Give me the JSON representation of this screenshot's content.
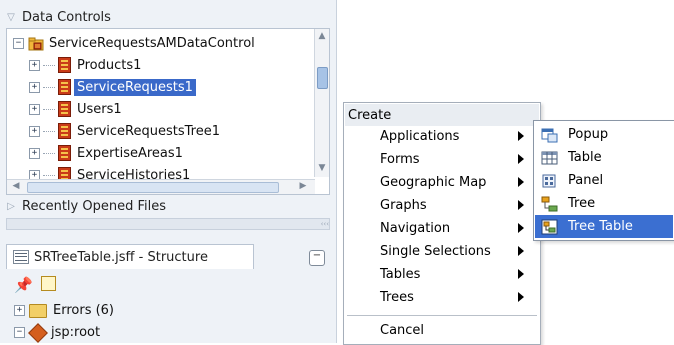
{
  "data_controls": {
    "header": "Data Controls",
    "root": "ServiceRequestsAMDataControl",
    "items": [
      {
        "label": "Products1"
      },
      {
        "label": "ServiceRequests1"
      },
      {
        "label": "Users1"
      },
      {
        "label": "ServiceRequestsTree1"
      },
      {
        "label": "ExpertiseAreas1"
      },
      {
        "label": "ServiceHistories1"
      }
    ],
    "selected_item": "ServiceRequests1"
  },
  "recent_files": {
    "header": "Recently Opened Files"
  },
  "structure": {
    "tab_title": "SRTreeTable.jsff - Structure",
    "nodes": [
      {
        "label": "Errors (6)"
      },
      {
        "label": "jsp:root"
      }
    ]
  },
  "context_menu": {
    "header": "Create",
    "items": [
      {
        "label": "Applications"
      },
      {
        "label": "Forms"
      },
      {
        "label": "Geographic Map"
      },
      {
        "label": "Graphs"
      },
      {
        "label": "Navigation"
      },
      {
        "label": "Single Selections"
      },
      {
        "label": "Tables"
      },
      {
        "label": "Trees"
      }
    ],
    "cancel": "Cancel"
  },
  "submenu": {
    "items": [
      {
        "label": "Popup",
        "icon": "popup-icon"
      },
      {
        "label": "Table",
        "icon": "table-icon"
      },
      {
        "label": "Panel",
        "icon": "panel-icon"
      },
      {
        "label": "Tree",
        "icon": "tree-icon"
      },
      {
        "label": "Tree Table",
        "icon": "tree-table-icon"
      }
    ],
    "highlighted": "Tree Table"
  },
  "colors": {
    "selection": "#3a69c9",
    "menu_highlight": "#3b6fd1",
    "panel_bg": "#eef2f7"
  }
}
